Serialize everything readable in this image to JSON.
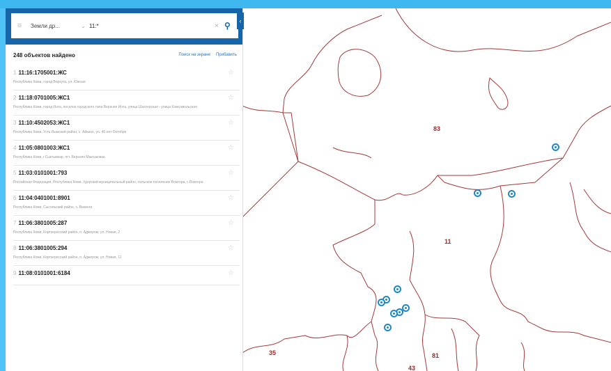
{
  "search": {
    "type_label": "Земли др...",
    "query": "11:*",
    "menu_glyph": "≡",
    "chevron_glyph": "⌄",
    "clear_glyph": "×",
    "search_glyph": "⚲",
    "collapse_glyph": "‹"
  },
  "results": {
    "count_label": "248 объектов найдено",
    "link_map": "Поиск на экране",
    "link_more": "Прибавить"
  },
  "items": [
    {
      "num": "1",
      "title": "11:16:1705001:ЖС",
      "address": "Республика Коми, город Воркута, ул. Южная",
      "star": "☆"
    },
    {
      "num": "2",
      "title": "11:18:0701005:ЖС1",
      "address": "Республика Коми, город Инта, поселок городского типа Верхняя Инта, улица Шахтерская - улица Комсомольская",
      "star": "☆"
    },
    {
      "num": "3",
      "title": "11:10:4502053:ЖС1",
      "address": "Республика Коми, Усть-Вымский район, с. Айкино, ул. 40 лет Октября",
      "star": "☆"
    },
    {
      "num": "4",
      "title": "11:05:0801003:ЖС1",
      "address": "Республика Коми, г.Сыктывкар, пгт. Верхняя Максаковка",
      "star": "☆"
    },
    {
      "num": "5",
      "title": "11:03:0101001:793",
      "address": "Российская Федерация, Республика Коми, Удорский муниципальный район, сельское поселение Вожгора, с.Вожгора",
      "star": "☆"
    },
    {
      "num": "6",
      "title": "11:04:0401001:8901",
      "address": "Республика Коми, Сысольский район, с. Визинга",
      "star": "☆"
    },
    {
      "num": "7",
      "title": "11:06:3801005:287",
      "address": "Республика Коми, Корткеросский район, п. Аджером, ул. Новая, 2",
      "star": "☆"
    },
    {
      "num": "8",
      "title": "11:06:3801005:294",
      "address": "Республика Коми, Корткеросский район, п. Аджером, ул. Новая, 11",
      "star": "☆"
    },
    {
      "num": "9",
      "title": "11:08:0101001:6184",
      "address": "",
      "star": "☆"
    }
  ],
  "map": {
    "region_labels": [
      "83",
      "11",
      "35",
      "43",
      "81"
    ],
    "border_color": "#a33a3a",
    "marker_color": "#1e88c7"
  }
}
